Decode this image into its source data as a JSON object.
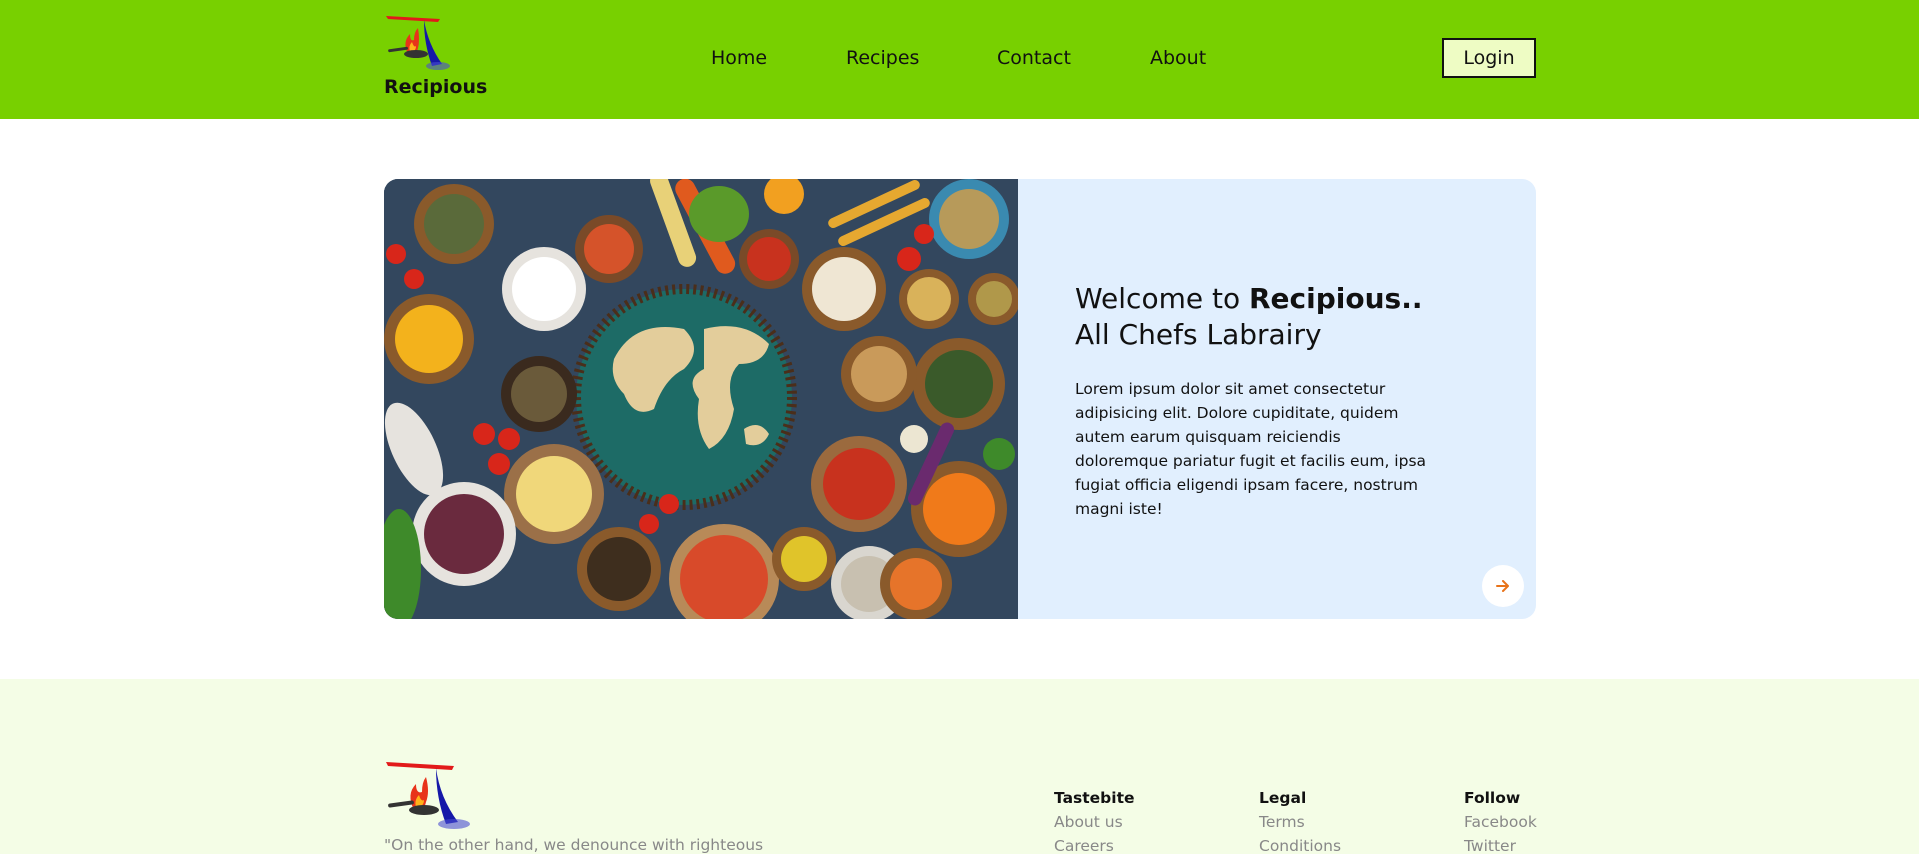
{
  "brand": {
    "name": "Recipious"
  },
  "nav": {
    "items": [
      "Home",
      "Recipes",
      "Contact",
      "About"
    ]
  },
  "header": {
    "login_label": "Login"
  },
  "hero": {
    "title_prefix": "Welcome to ",
    "title_bold": "Recipious..",
    "title_line2": "All Chefs Labrairy",
    "description": "Lorem ipsum dolor sit amet consectetur adipisicing elit. Dolore cupiditate, quidem autem earum quisquam reiciendis doloremque pariatur fugit et facilis eum, ipsa fugiat officia eligendi ipsam facere, nostrum magni iste!",
    "next_icon": "arrow-right-icon"
  },
  "footer": {
    "quote": "\"On the other hand, we denounce with righteous",
    "columns": [
      {
        "title": "Tastebite",
        "links": [
          "About us",
          "Careers"
        ]
      },
      {
        "title": "Legal",
        "links": [
          "Terms",
          "Conditions"
        ]
      },
      {
        "title": "Follow",
        "links": [
          "Facebook",
          "Twitter"
        ]
      }
    ]
  },
  "colors": {
    "header_bg": "#78d000",
    "hero_panel_bg": "#e1effe",
    "footer_bg": "#f4fde6",
    "login_bg": "#eefcc4",
    "accent_arrow": "#e8731a"
  }
}
